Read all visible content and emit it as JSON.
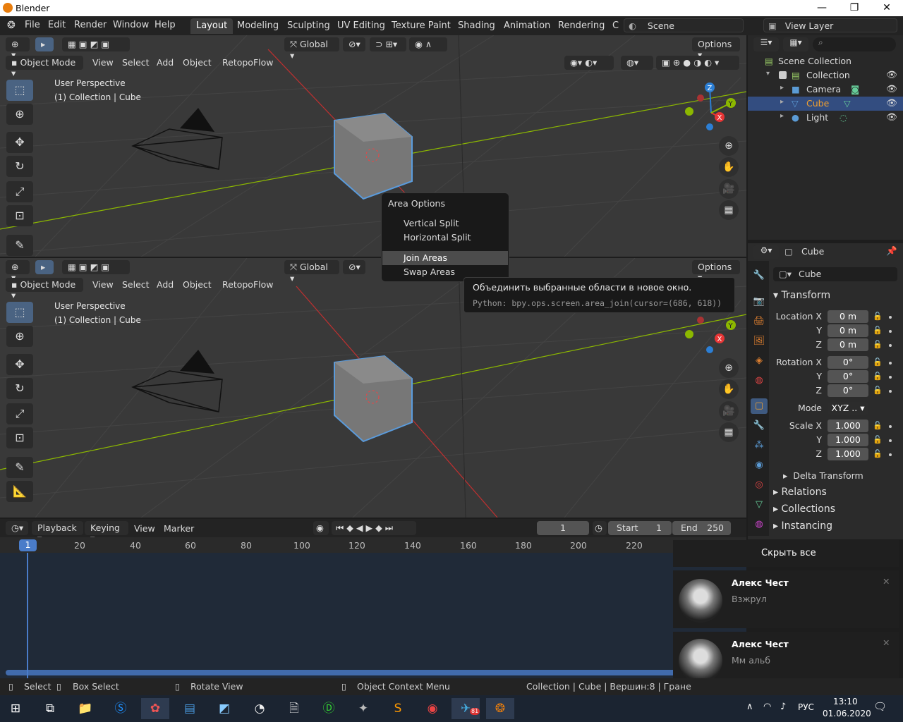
{
  "window": {
    "title": "Blender",
    "minimize": "—",
    "maximize": "❐",
    "close": "✕"
  },
  "menu": [
    "File",
    "Edit",
    "Render",
    "Window",
    "Help"
  ],
  "workspaces": [
    "Layout",
    "Modeling",
    "Sculpting",
    "UV Editing",
    "Texture Paint",
    "Shading",
    "Animation",
    "Rendering",
    "C"
  ],
  "scene": "Scene",
  "view_layer": "View Layer",
  "viewport": {
    "transform_orientation": "Global",
    "options_label": "Options",
    "mode": "Object Mode",
    "menus": [
      "View",
      "Select",
      "Add",
      "Object",
      "RetopoFlow"
    ],
    "perspective": "User Perspective",
    "collection_info": "(1) Collection | Cube",
    "axes": {
      "z": "Z",
      "y": "Y",
      "x": "X"
    }
  },
  "context_menu": {
    "title": "Area Options",
    "items": [
      "Vertical Split",
      "Horizontal Split",
      "Join Areas",
      "Swap Areas"
    ],
    "highlighted": "Join Areas"
  },
  "tooltip": {
    "text": "Объединить выбранные области в новое окно.",
    "python": "Python: bpy.ops.screen.area_join(cursor=(686, 618))"
  },
  "outliner": {
    "root": "Scene Collection",
    "items": [
      {
        "name": "Collection",
        "level": 1
      },
      {
        "name": "Camera",
        "level": 2
      },
      {
        "name": "Cube",
        "level": 2,
        "selected": true
      },
      {
        "name": "Light",
        "level": 2
      }
    ]
  },
  "properties": {
    "object_name": "Cube",
    "datablock": "Cube",
    "transform_title": "Transform",
    "location_label": "Location X",
    "rotation_label": "Rotation X",
    "scale_label": "Scale X",
    "mode_label": "Mode",
    "y": "Y",
    "z": "Z",
    "location": [
      "0 m",
      "0 m",
      "0 m"
    ],
    "rotation": [
      "0°",
      "0°",
      "0°"
    ],
    "mode": "XYZ ..",
    "scale": [
      "1.000",
      "1.000",
      "1.000"
    ],
    "delta": "Delta Transform",
    "sections": [
      "Relations",
      "Collections",
      "Instancing"
    ]
  },
  "timeline": {
    "menus": [
      "Playback",
      "Keying",
      "View",
      "Marker"
    ],
    "current_frame": "1",
    "start_label": "Start",
    "start": "1",
    "end_label": "End",
    "end": "250",
    "ruler": [
      "1",
      "20",
      "40",
      "60",
      "80",
      "100",
      "120",
      "140",
      "160",
      "180",
      "200",
      "220"
    ]
  },
  "notifications": {
    "hide_all": "Скрыть все",
    "items": [
      {
        "name": "Алекс Чест",
        "text": "Взжрул"
      },
      {
        "name": "Алекс Чест",
        "text": "Мм альб"
      }
    ]
  },
  "statusbar": {
    "select": "Select",
    "box_select": "Box Select",
    "rotate_view": "Rotate View",
    "context_menu": "Object Context Menu",
    "stats": "Collection | Cube | Вершин:8 | Гране"
  },
  "taskbar": {
    "lang": "РУС",
    "time": "13:10",
    "date": "01.06.2020",
    "badge": "81"
  },
  "colors": {
    "accent": "#4a6382",
    "selected_row": "#334d80",
    "axis_x": "#e83535",
    "axis_y": "#8cb800",
    "axis_z": "#2c7fd5",
    "viewport_bg": "#393939"
  }
}
